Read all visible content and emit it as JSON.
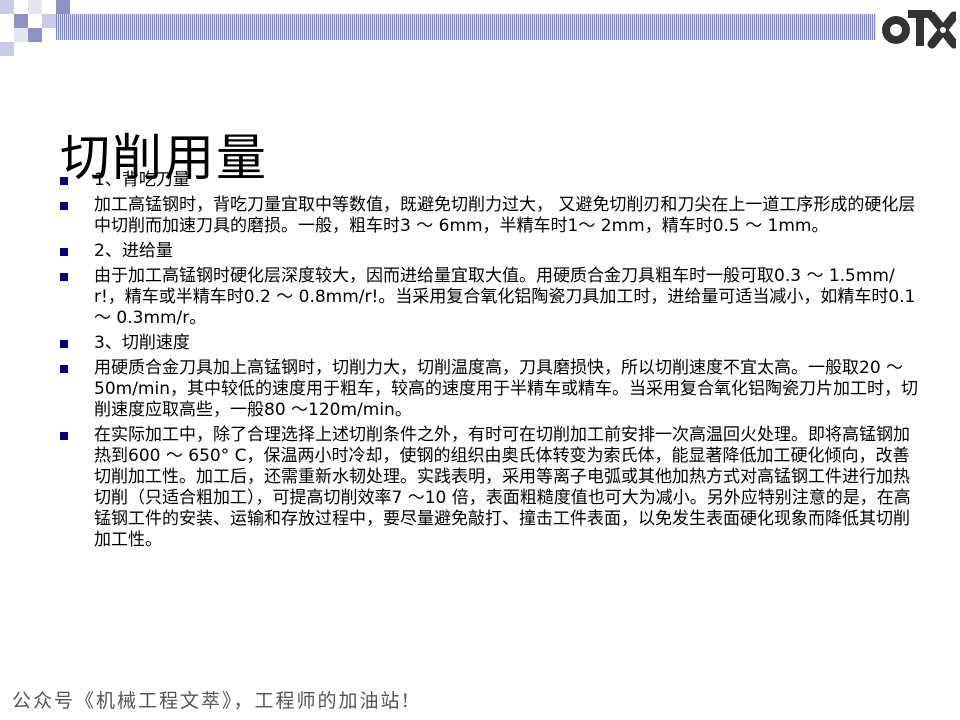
{
  "slide": {
    "title": "切削用量",
    "bullets": [
      "1、背吃刀量",
      "加工高锰钢时，背吃刀量宜取中等数值，既避免切削力过大， 又避免切削刃和刀尖在上一道工序形成的硬化层中切削而加速刀具的磨损。一般，粗车时3 ～ 6mm，半精车时1～ 2mm，精车时0.5 ～ 1mm。",
      "2、进给量",
      "由于加工高锰钢时硬化层深度较大，因而进给量宜取大值。用硬质合金刀具粗车时一般可取0.3 ～ 1.5mm/r!，精车或半精车时0.2 ～ 0.8mm/r!。当采用复合氧化铝陶瓷刀具加工时，进给量可适当减小，如精车时0.1 ～ 0.3mm/r。",
      "3、切削速度",
      "用硬质合金刀具加上高锰钢时，切削力大，切削温度高，刀具磨损快，所以切削速度不宜太高。一般取20 ～ 50m/min，其中较低的速度用于粗车，较高的速度用于半精车或精车。当采用复合氧化铝陶瓷刀片加工时，切削速度应取高些，一般80 ～120m/min。",
      "在实际加工中，除了合理选择上述切削条件之外，有时可在切削加工前安排一次高温回火处理。即将高锰钢加热到600 ～ 650° C，保温两小时冷却，使钢的组织由奥氏体转变为索氏体，能显著降低加工硬化倾向，改善切削加工性。加工后，还需重新水韧处理。实践表明，采用等离子电弧或其他加热方式对高锰钢工件进行加热切削（只适合粗加工），可提高切削效率7 ～10 倍，表面粗糙度值也可大为减小。另外应特别注意的是，在高锰钢工件的安装、运输和存放过程中，要尽量避免敲打、撞击工件表面，以免发生表面硬化现象而降低其切削加工性。"
    ],
    "footer": "公众号《机械工程文萃》，工程师的加油站!"
  },
  "icons": {
    "bullet": "square-bullet-icon",
    "logo": "company-logo-icon"
  },
  "colors": {
    "bullet": "#000080",
    "deco_bar": "#6b74b0",
    "deco_squares": "#8c93c4",
    "footer": "#555555"
  }
}
